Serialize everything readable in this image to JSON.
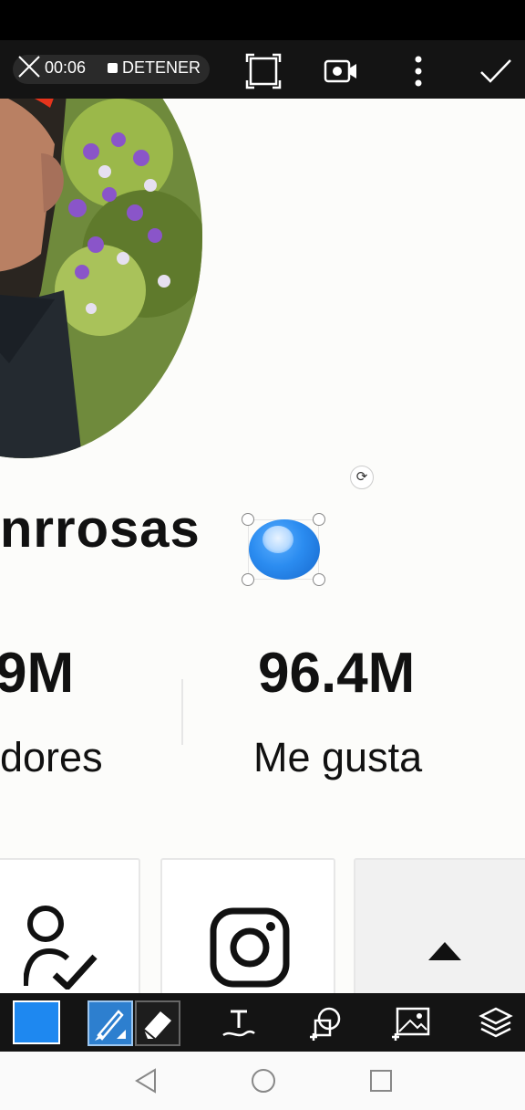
{
  "recording": {
    "time": "00:06",
    "stop_label": "DETENER"
  },
  "profile": {
    "username": "nrrosas",
    "stats": [
      {
        "value": "9M",
        "label": "dores"
      },
      {
        "value": "96.4M",
        "label": "Me gusta"
      }
    ]
  },
  "colors": {
    "accent": "#1e88f0",
    "toolbar_bg": "#141414",
    "sticker_blue": "#2b8cf0"
  },
  "icons": {
    "topbar": [
      "close-icon",
      "stop-icon",
      "crop-icon",
      "video-camera-icon",
      "more-vert-icon",
      "check-icon"
    ],
    "cards": [
      "follow-user-icon",
      "instagram-icon",
      "caret-up-icon"
    ],
    "toolbar": [
      "color-swatch",
      "brush-icon",
      "eraser-icon",
      "text-icon",
      "shape-add-icon",
      "image-add-icon",
      "layers-icon"
    ],
    "nav": [
      "back-icon",
      "home-icon",
      "recents-icon"
    ]
  }
}
